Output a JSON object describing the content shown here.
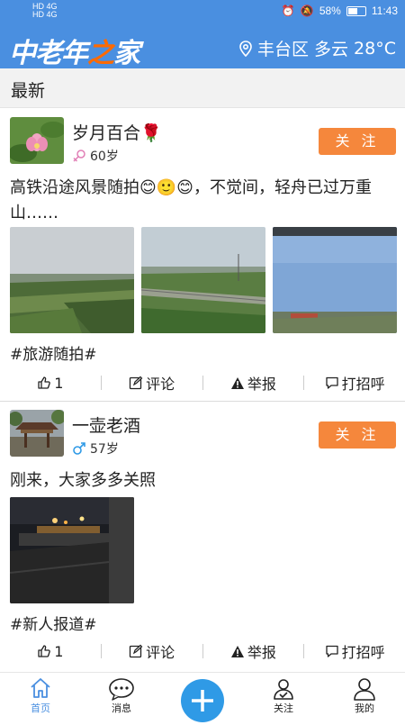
{
  "status": {
    "left_top": "HD 4G",
    "left_bottom": "HD 4G",
    "battery": "58%",
    "battery_level": 0.58,
    "time": "11:43"
  },
  "header": {
    "logo_text": "中老年",
    "logo_accent": "之",
    "logo_tail": "家",
    "location": "丰台区",
    "weather": "多云",
    "temperature": "28°C"
  },
  "section": {
    "title": "最新"
  },
  "posts": [
    {
      "username": "岁月百合🌹",
      "age": "60岁",
      "gender_icon": "female-icon",
      "follow_label": "关 注",
      "content": "高铁沿途风景随拍😊🙂😊，不觉间，轻舟已过万重山……",
      "tag": "#旅游随拍#",
      "likes": "1",
      "comment_label": "评论",
      "report_label": "举报",
      "greet_label": "打招呼"
    },
    {
      "username": "一壶老酒",
      "age": "57岁",
      "gender_icon": "male-icon",
      "follow_label": "关 注",
      "content": "刚来，大家多多关照",
      "tag": "#新人报道#",
      "likes": "1",
      "comment_label": "评论",
      "report_label": "举报",
      "greet_label": "打招呼"
    }
  ],
  "tabbar": {
    "home": "首页",
    "messages": "消息",
    "follow": "关注",
    "mine": "我的"
  },
  "colors": {
    "brand": "#4a8fe0",
    "follow_button": "#f5873c",
    "plus_button": "#2f9ae6"
  }
}
